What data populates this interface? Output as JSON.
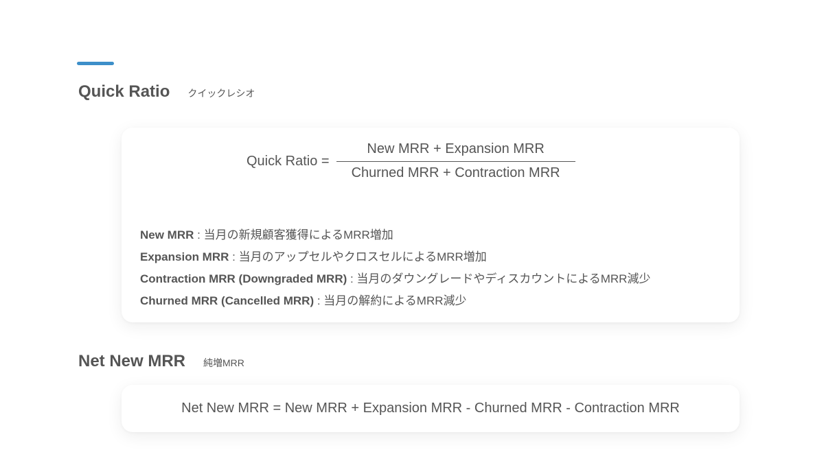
{
  "quick_ratio": {
    "title": "Quick Ratio",
    "subtitle": "クイックレシオ",
    "formula": {
      "lhs": "Quick Ratio =",
      "numerator": "New MRR + Expansion MRR",
      "denominator": "Churned MRR + Contraction MRR"
    },
    "definitions": [
      {
        "term": "New MRR",
        "desc": " : 当月の新規顧客獲得によるMRR増加"
      },
      {
        "term": "Expansion MRR",
        "desc": " : 当月のアップセルやクロスセルによるMRR増加"
      },
      {
        "term": "Contraction MRR (Downgraded MRR)",
        "desc": " : 当月のダウングレードやディスカウントによるMRR減少"
      },
      {
        "term": "Churned MRR (Cancelled MRR)",
        "desc": " : 当月の解約によるMRR減少"
      }
    ]
  },
  "net_new_mrr": {
    "title": "Net New MRR",
    "subtitle": "純増MRR",
    "formula": "Net New MRR = New MRR + Expansion MRR - Churned MRR - Contraction MRR"
  },
  "colors": {
    "accent": "#3d8fc9",
    "text": "#555555",
    "card_bg": "#ffffff"
  }
}
